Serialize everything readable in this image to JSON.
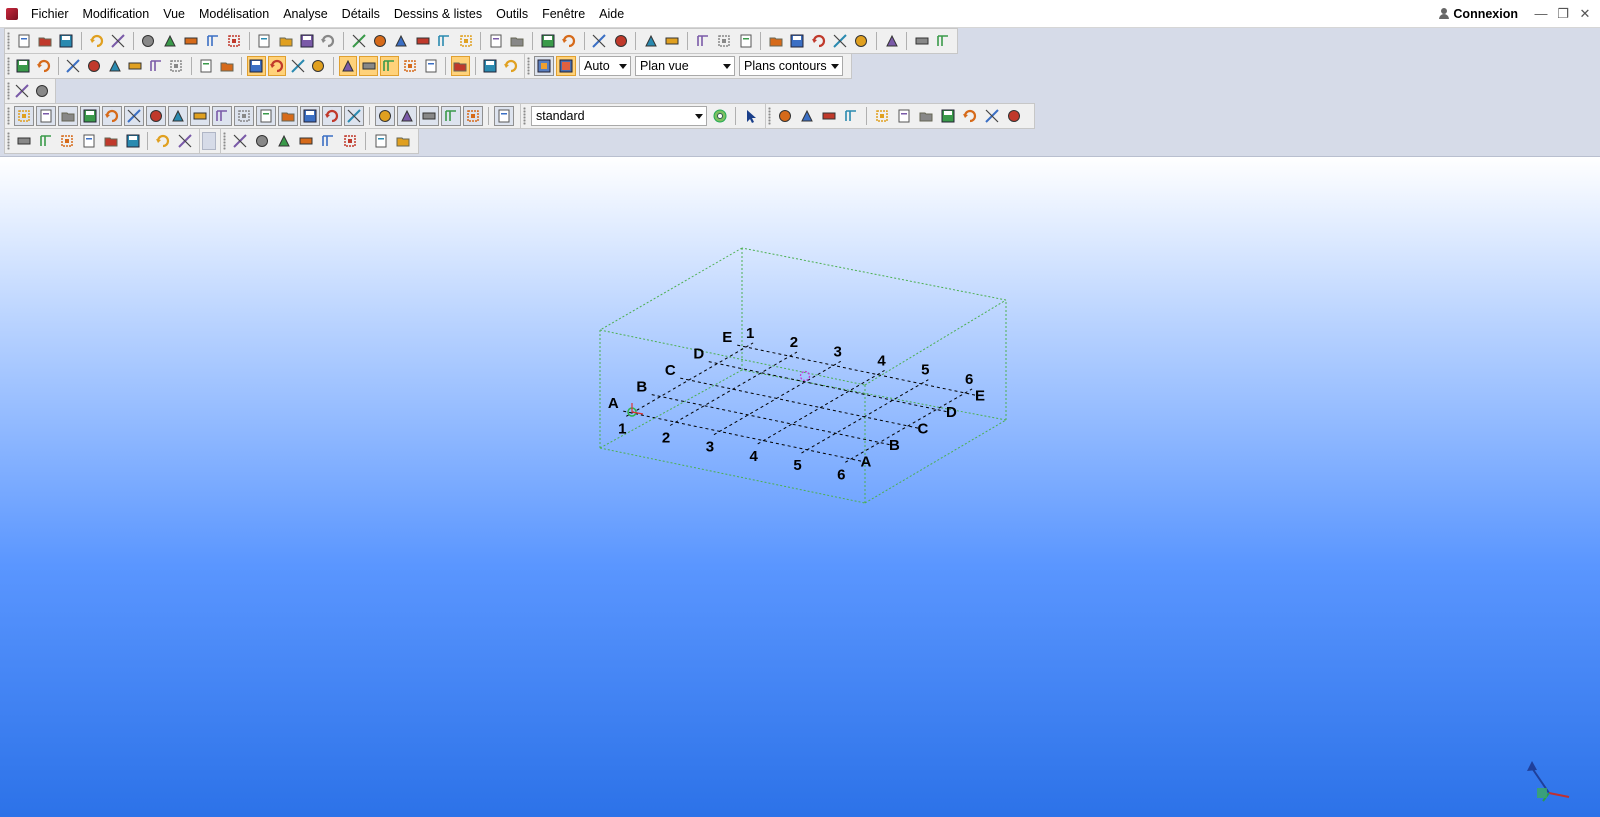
{
  "menu": {
    "items": [
      "Fichier",
      "Modification",
      "Vue",
      "Modélisation",
      "Analyse",
      "Détails",
      "Dessins & listes",
      "Outils",
      "Fenêtre",
      "Aide"
    ],
    "user": "Connexion"
  },
  "toolbar": {
    "row2_combos": {
      "mode": "Auto",
      "view_plane": "Plan vue",
      "contours": "Plans contours"
    },
    "row4_combo": "standard"
  },
  "model": {
    "grid_x_labels": [
      "1",
      "2",
      "3",
      "4",
      "5",
      "6"
    ],
    "grid_y_labels": [
      "A",
      "B",
      "C",
      "D",
      "E"
    ]
  },
  "colors": {
    "viewport_top": "#ffffff",
    "viewport_bottom": "#2c72e8",
    "workplane_box": "#4caf50",
    "grid_lines": "#000000",
    "toolbar_bg": "#f0f0f0"
  }
}
